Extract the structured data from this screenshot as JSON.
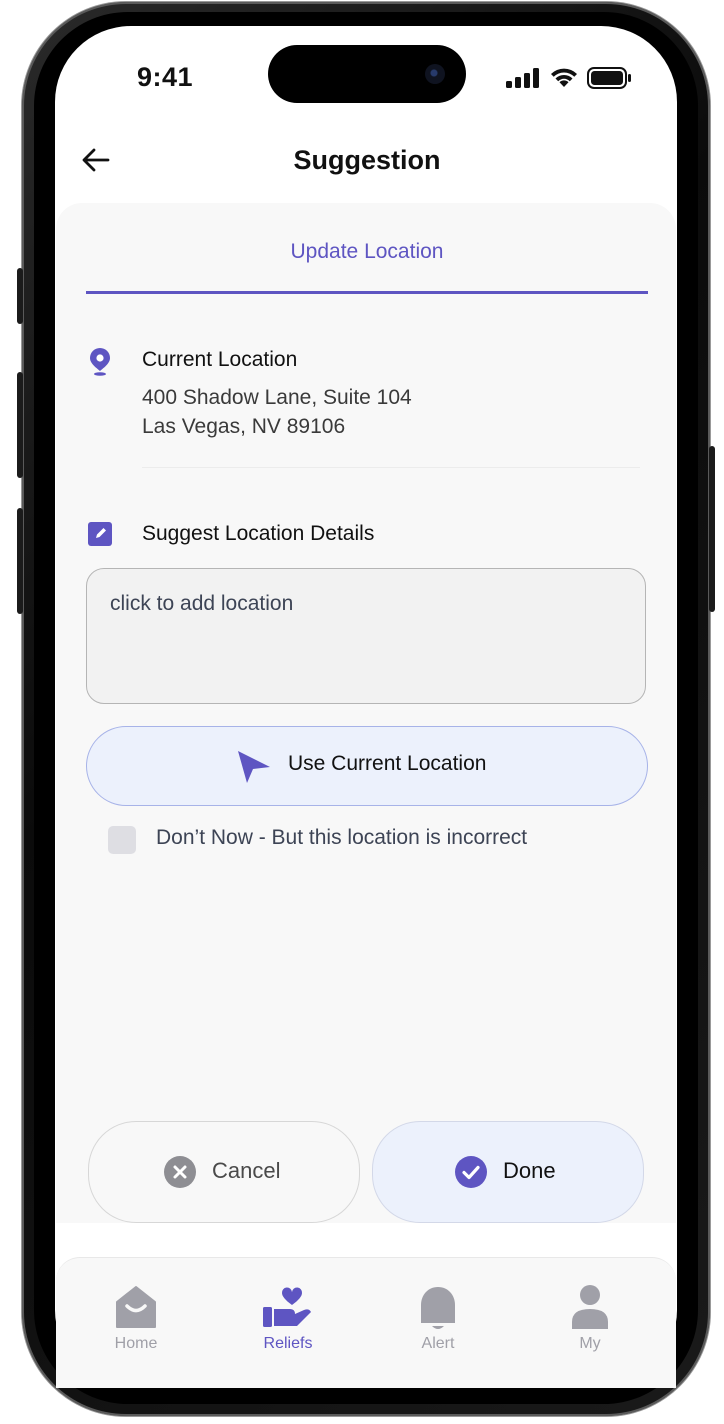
{
  "status_bar": {
    "time": "9:41"
  },
  "header": {
    "title": "Suggestion",
    "back_icon": "arrow-left-icon"
  },
  "tabs": {
    "active_label": "Update Location"
  },
  "current_location": {
    "label": "Current Location",
    "address_line1": "400 Shadow Lane, Suite 104",
    "address_line2": "Las Vegas, NV 89106",
    "icon": "location-pin-icon"
  },
  "suggest": {
    "label": "Suggest Location Details",
    "icon": "edit-icon",
    "placeholder": "click to add location"
  },
  "use_current": {
    "label": "Use Current Location",
    "icon": "navigation-arrow-icon"
  },
  "incorrect_checkbox": {
    "label": "Don’t Now - But this location is incorrect",
    "checked": false
  },
  "actions": {
    "cancel_label": "Cancel",
    "done_label": "Done"
  },
  "tabbar": {
    "items": [
      {
        "label": "Home",
        "icon": "home-icon",
        "active": false
      },
      {
        "label": "Reliefs",
        "icon": "heart-hand-icon",
        "active": true
      },
      {
        "label": "Alert",
        "icon": "bell-icon",
        "active": false
      },
      {
        "label": "My",
        "icon": "user-icon",
        "active": false
      }
    ]
  },
  "colors": {
    "accent": "#5e55c2",
    "accent_light": "#ecf1fc",
    "muted": "#a0a0a8"
  }
}
